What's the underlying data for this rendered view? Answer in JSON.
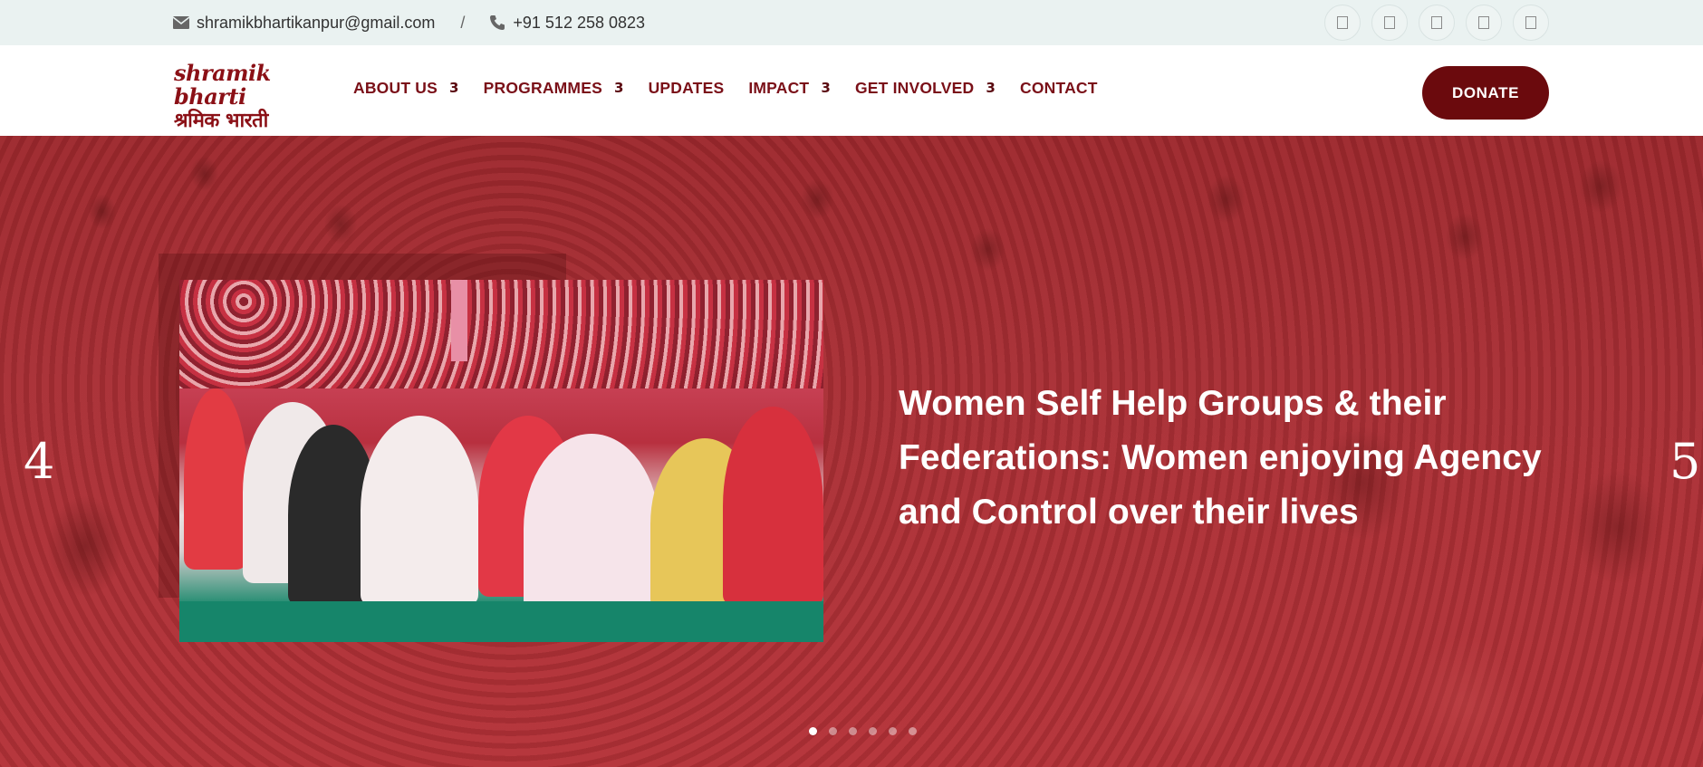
{
  "topbar": {
    "email": "shramikbhartikanpur@gmail.com",
    "separator": "/",
    "phone": "+91 512 258 0823",
    "email_icon": "envelope-icon",
    "phone_icon": "phone-icon",
    "socials": [
      "facebook-icon",
      "twitter-icon",
      "instagram-icon",
      "youtube-icon",
      "linkedin-icon"
    ]
  },
  "header": {
    "logo_en": "shramik bharti",
    "logo_hi": "श्रमिक भारती",
    "nav": [
      {
        "label": "ABOUT US",
        "chevron": "3"
      },
      {
        "label": "PROGRAMMES",
        "chevron": "3"
      },
      {
        "label": "UPDATES",
        "chevron": ""
      },
      {
        "label": "IMPACT",
        "chevron": "3"
      },
      {
        "label": "GET INVOLVED",
        "chevron": "3"
      },
      {
        "label": "CONTACT",
        "chevron": ""
      }
    ],
    "donate_label": "DONATE"
  },
  "hero": {
    "title": "Women Self Help Groups & their Federations: Women enjoying Agency and Control over their lives",
    "prev_arrow": "4",
    "next_arrow": "5",
    "slide_count": 6,
    "active_slide": 1
  },
  "colors": {
    "brand": "#6b0a0d",
    "nav_text": "#7a1018",
    "topbar_bg": "#eaf2f1",
    "hero_overlay": "#a8333a"
  }
}
